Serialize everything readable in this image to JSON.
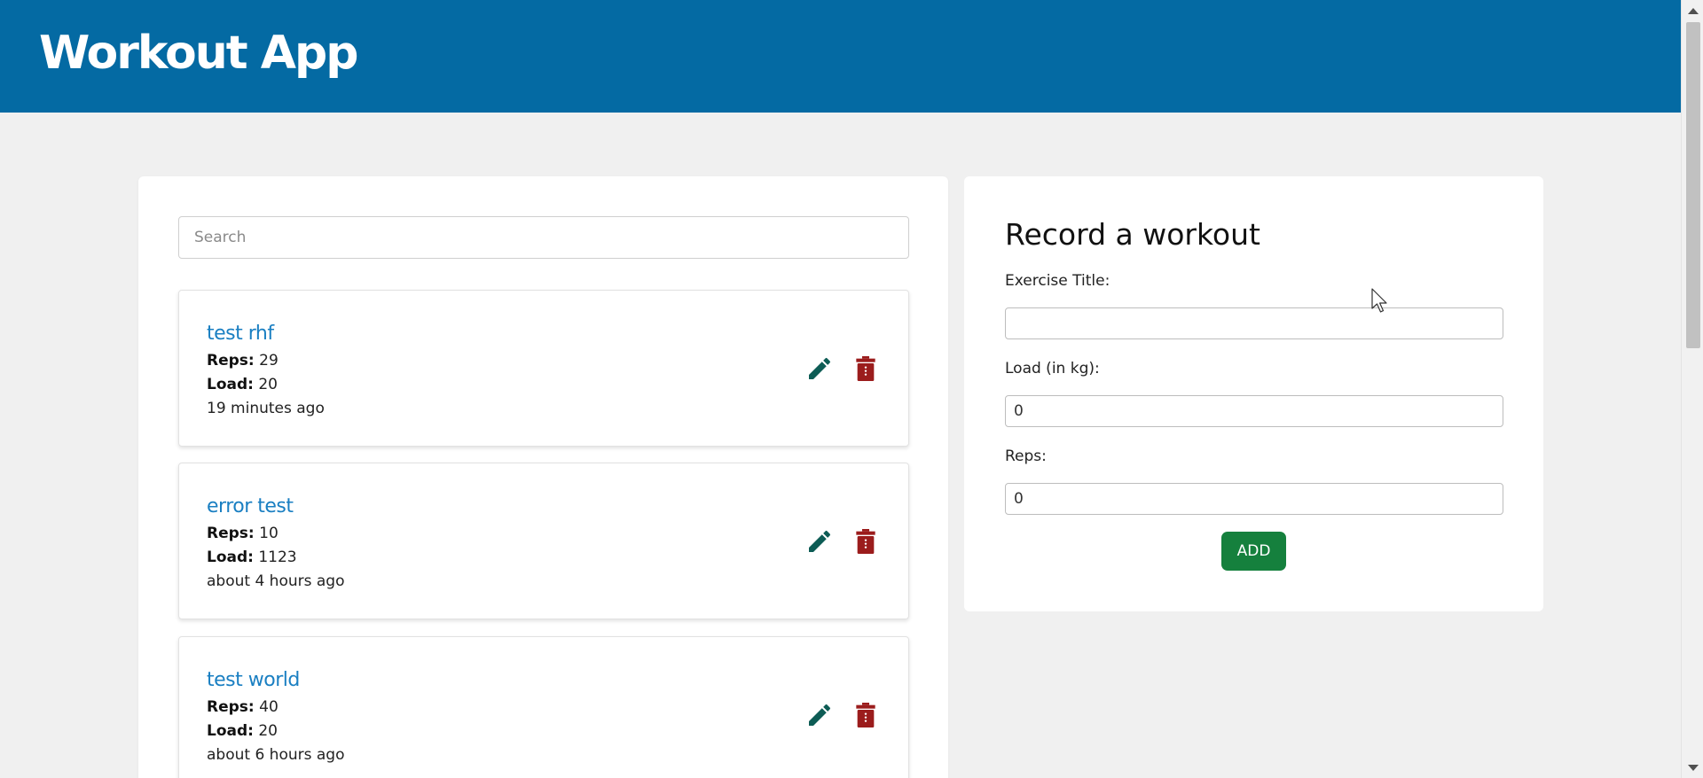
{
  "header": {
    "title": "Workout App"
  },
  "search": {
    "placeholder": "Search",
    "value": ""
  },
  "workouts": [
    {
      "title": "test rhf",
      "reps_label": "Reps:",
      "reps": "29",
      "load_label": "Load:",
      "load": "20",
      "time": "19 minutes ago"
    },
    {
      "title": "error test",
      "reps_label": "Reps:",
      "reps": "10",
      "load_label": "Load:",
      "load": "1123",
      "time": "about 4 hours ago"
    },
    {
      "title": "test world",
      "reps_label": "Reps:",
      "reps": "40",
      "load_label": "Load:",
      "load": "20",
      "time": "about 6 hours ago"
    }
  ],
  "form": {
    "title": "Record a workout",
    "exercise_label": "Exercise Title:",
    "exercise_value": "",
    "load_label": "Load (in kg):",
    "load_value": "0",
    "reps_label": "Reps:",
    "reps_value": "0",
    "add_label": "ADD"
  },
  "icons": {
    "edit": "pencil-icon",
    "delete": "trash-icon"
  },
  "colors": {
    "header_bg": "#046aa3",
    "workout_title": "#1a7fc2",
    "edit_icon": "#0d5c55",
    "delete_icon": "#9b1c1c",
    "add_button": "#15803d",
    "page_bg": "#f0f0f0"
  }
}
